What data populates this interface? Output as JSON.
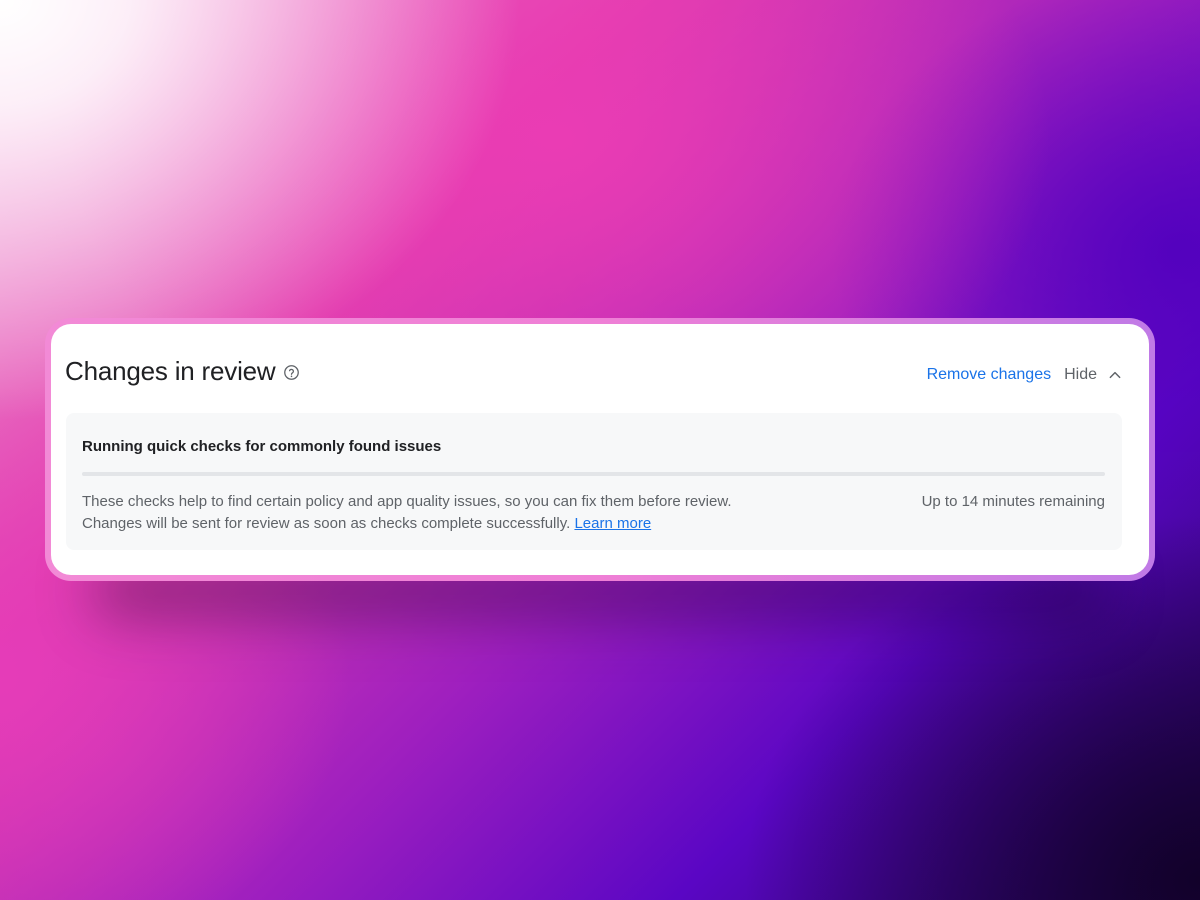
{
  "header": {
    "title": "Changes in review",
    "help_icon": "help-circle-icon",
    "remove_label": "Remove changes",
    "hide_label": "Hide",
    "collapse_icon": "chevron-up-icon"
  },
  "checks": {
    "title": "Running quick checks for commonly found issues",
    "progress_percent": 0,
    "description_line1": "These checks help to find certain policy and app quality issues, so you can fix them before review.",
    "description_line2": "Changes will be sent for review as soon as checks complete successfully.",
    "learn_more_label": "Learn more",
    "remaining": "Up to 14 minutes remaining"
  },
  "colors": {
    "accent": "#1a73e8",
    "text_primary": "#202124",
    "text_secondary": "#5f6368",
    "panel_bg": "#f7f8f9"
  }
}
